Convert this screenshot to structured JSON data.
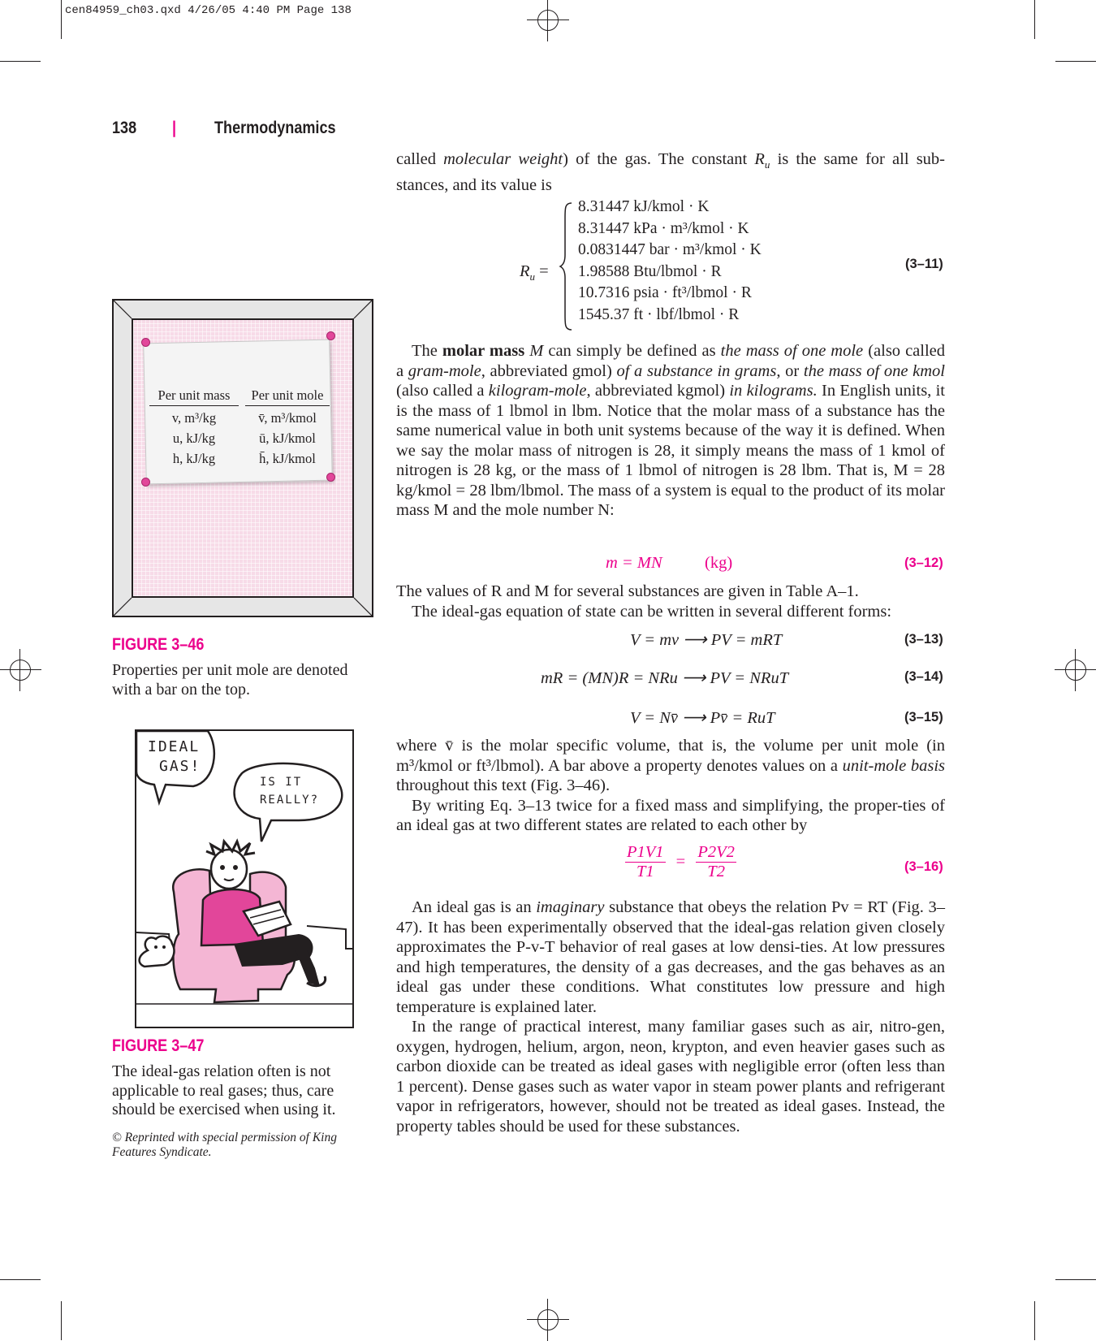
{
  "slug": "cen84959_ch03.qxd  4/26/05  4:40 PM  Page 138",
  "header": {
    "page_number": "138",
    "separator": "|",
    "book_title": "Thermodynamics"
  },
  "figure_46": {
    "table": {
      "col1_header": "Per unit mass",
      "col2_header": "Per unit mole",
      "col1_rows": [
        "v, m³/kg",
        "u, kJ/kg",
        "h, kJ/kg"
      ],
      "col2_rows": [
        "v̄, m³/kmol",
        "ū, kJ/kmol",
        "h̄, kJ/kmol"
      ]
    },
    "label": "FIGURE 3–46",
    "caption_line1": "Properties per unit mole are denoted",
    "caption_line2": "with a bar on the top."
  },
  "figure_47": {
    "bubble1_line1": "IDEAL",
    "bubble1_line2": "GAS!",
    "bubble2_line1": "IS IT",
    "bubble2_line2": "REALLY?",
    "label": "FIGURE 3–47",
    "caption_line1": "The ideal-gas relation often is not",
    "caption_line2": "applicable to real gases; thus, care",
    "caption_line3": "should be exercised when using it.",
    "credit_line1": "© Reprinted with special permission of King",
    "credit_line2": "Features Syndicate."
  },
  "text": {
    "p0_a": "called ",
    "p0_b": "molecular weight",
    "p0_c": ") of the gas. The constant ",
    "p0_d": " is the same for all sub-stances, and its value is",
    "p1_a": "The ",
    "p1_b": "molar mass",
    "p1_c": " can simply be defined as ",
    "p1_d": "the mass of one mole",
    "p1_e": " (also called a ",
    "p1_f": "gram-mole",
    "p1_g": ", abbreviated gmol) ",
    "p1_h": "of a substance in grams",
    "p1_i": ", or ",
    "p1_j": "the mass of one kmol",
    "p1_k": " (also called a ",
    "p1_l": "kilogram-mole",
    "p1_m": ", abbreviated kgmol) ",
    "p1_n": "in kilograms.",
    "p1_o": " In English units, it is the mass of 1 lbmol in lbm. Notice that the molar mass of a substance has the same numerical value in both unit systems because of the way it is defined. When we say the molar mass of nitrogen is 28, it simply means the mass of 1 kmol of nitrogen is 28 kg, or the mass of 1 lbmol of nitrogen is 28 lbm. That is, M = 28 kg/kmol = 28 lbm/lbmol. The mass of a system is equal to the product of its molar mass M and the mole number N:",
    "p2": "The values of R and M for several substances are given in Table A–1.",
    "p3": "The ideal-gas equation of state can be written in several different forms:",
    "p4_a": "where v̄ is the molar specific volume, that is, the volume per unit mole (in m³/kmol or ft³/lbmol). A bar above a property denotes values on a ",
    "p4_b": "unit-mole basis",
    "p4_c": " throughout this text (Fig. 3–46).",
    "p5": "By writing Eq. 3–13 twice for a fixed mass and simplifying, the proper-ties of an ideal gas at two different states are related to each other by",
    "p6_a": "An ideal gas is an ",
    "p6_b": "imaginary",
    "p6_c": " substance that obeys the relation Pv = RT (Fig. 3–47). It has been experimentally observed that the ideal-gas relation given closely approximates the P-v-T behavior of real gases at low densi-ties. At low pressures and high temperatures, the density of a gas decreases, and the gas behaves as an ideal gas under these conditions. What constitutes low pressure and high temperature is explained later.",
    "p7": "In the range of practical interest, many familiar gases such as air, nitro-gen, oxygen, hydrogen, helium, argon, neon, krypton, and even heavier gases such as carbon dioxide can be treated as ideal gases with negligible error (often less than 1 percent). Dense gases such as water vapor in steam power plants and refrigerant vapor in refrigerators, however, should not be treated as ideal gases. Instead, the property tables should be used for these substances."
  },
  "equations": {
    "eq11_lhs": "Ru =",
    "eq11_values": [
      "8.31447 kJ/kmol · K",
      "8.31447 kPa · m³/kmol · K",
      "0.0831447 bar · m³/kmol · K",
      "1.98588 Btu/lbmol · R",
      "10.7316 psia · ft³/lbmol · R",
      "1545.37 ft · lbf/lbmol · R"
    ],
    "eq11_num": "(3–11)",
    "eq12": "m = MN",
    "eq12_unit": "(kg)",
    "eq12_num": "(3–12)",
    "eq13": "V = mv ⟶ PV = mRT",
    "eq13_num": "(3–13)",
    "eq14": "mR = (MN)R = NRu ⟶ PV = NRuT",
    "eq14_num": "(3–14)",
    "eq15": "V = Nv̄ ⟶ Pv̄ = RuT",
    "eq15_num": "(3–15)",
    "eq16_left_num": "P1V1",
    "eq16_left_den": "T1",
    "eq16_eq": "=",
    "eq16_right_num": "P2V2",
    "eq16_right_den": "T2",
    "eq16_num": "(3–16)"
  },
  "colors": {
    "accent": "#ec008c",
    "text": "#231f20",
    "board": "#f7dbe8"
  }
}
